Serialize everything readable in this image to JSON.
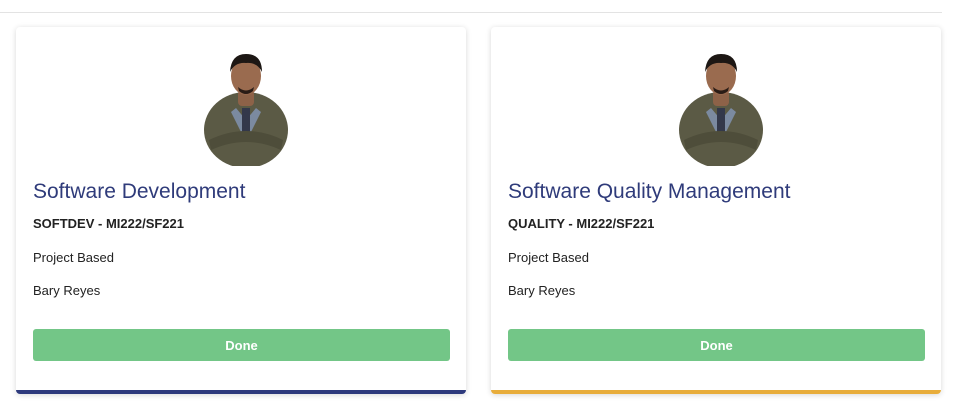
{
  "cards": [
    {
      "title": "Software Development",
      "code": "SOFTDEV - MI222/SF221",
      "type": "Project Based",
      "teacher": "Bary Reyes",
      "button_label": "Done",
      "accent_color": "#2e3a7d"
    },
    {
      "title": "Software Quality Management",
      "code": "QUALITY - MI222/SF221",
      "type": "Project Based",
      "teacher": "Bary Reyes",
      "button_label": "Done",
      "accent_color": "#e8ad3b"
    }
  ],
  "colors": {
    "title": "#2f3b7a",
    "button": "#73c687"
  }
}
